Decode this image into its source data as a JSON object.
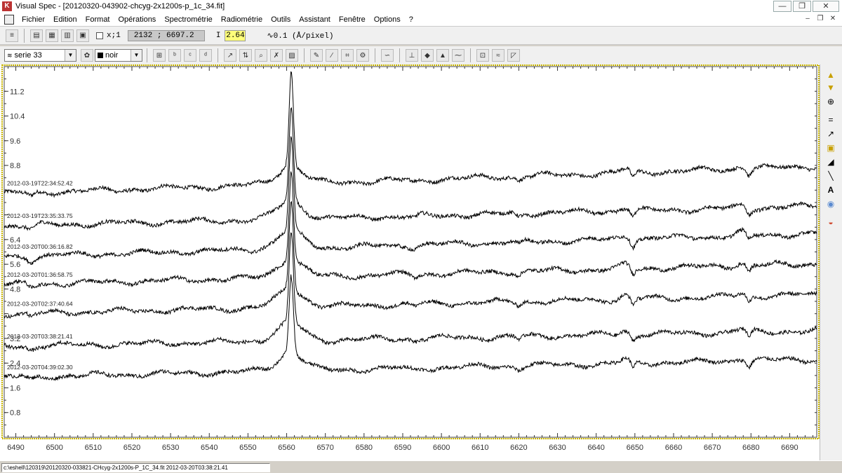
{
  "window": {
    "title": "Visual Spec - [20120320-043902-chcyg-2x1200s-p_1c_34.fit]",
    "app_icon_glyph": "K",
    "minimize_glyph": "—",
    "maximize_glyph": "❐",
    "close_glyph": "✕"
  },
  "menu": {
    "items": [
      "Fichier",
      "Edition",
      "Format",
      "Opérations",
      "Spectrométrie",
      "Radiométrie",
      "Outils",
      "Assistant",
      "Fenêtre",
      "Options",
      "?"
    ],
    "mdi_min_glyph": "–",
    "mdi_restore_glyph": "❐",
    "mdi_close_glyph": "✕"
  },
  "toolbar1": {
    "zoom_label": "x;1",
    "coords": "2132 ; 6697.2",
    "intensity_label": "I",
    "intensity_value": "2.64",
    "dispersion_label": "0.1 (Å/pixel)"
  },
  "toolbar2": {
    "series_value": "serie 33",
    "color_value": "noir"
  },
  "icons": {
    "toolbar1": [
      "columns-icon",
      "open-folder-icon",
      "open-profile-icon",
      "print-icon",
      "save-icon"
    ],
    "toolbar2": [
      "grid-icon",
      "axis-b-icon",
      "axis-c-icon",
      "axis-d-icon",
      "cursor-icon",
      "scale-icon",
      "zoom-icon",
      "delete-icon",
      "image-icon",
      "pen-icon",
      "line-icon",
      "measure-icon",
      "calibrate-icon",
      "continuum-icon",
      "drop-icon",
      "flux-icon",
      "chart-icon",
      "wave-icon",
      "table-icon",
      "chart-alt-icon",
      "spectrum-icon"
    ],
    "right": [
      "arrow-up-icon",
      "arrow-down-icon",
      "lock-icon",
      "equals-icon",
      "graph-icon",
      "rectangle-icon",
      "gradient-icon",
      "line-tool-icon",
      "text-tool-icon",
      "disk-icon",
      "rainbow-icon"
    ]
  },
  "statusbar": {
    "path": "c:\\eshell\\120319\\20120320-033821-CHcyg-2x1200s-P_1C_34.fit 2012-03-20T03:38:21.41"
  },
  "colors": {
    "frame": "#c8b400",
    "trace": "#000000",
    "intensity_bg": "#ffff7a"
  },
  "chart_data": {
    "type": "line",
    "xlim": [
      6487,
      6697
    ],
    "ylim": [
      0.0,
      12.0
    ],
    "x_ticks": [
      6490,
      6500,
      6510,
      6520,
      6530,
      6540,
      6550,
      6560,
      6570,
      6580,
      6590,
      6600,
      6610,
      6620,
      6630,
      6640,
      6650,
      6660,
      6670,
      6680,
      6690
    ],
    "y_ticks": [
      0.8,
      1.6,
      2.4,
      3.2,
      4.0,
      4.8,
      5.6,
      6.4,
      7.2,
      8.0,
      8.8,
      9.6,
      10.4,
      11.2
    ],
    "y_tick_labels": [
      "0.8",
      "1.6",
      "2.4",
      "3.2",
      "",
      "4.8",
      "5.6",
      "6.4",
      "",
      "",
      "8.8",
      "9.6",
      "10.4",
      "11.2"
    ],
    "line_center": 6561.2,
    "series": [
      {
        "name": "2012-03-19T22:34:52.42",
        "baseline": 7.9,
        "peak": 3.05,
        "slope": 0.0042
      },
      {
        "name": "2012-03-19T23:35:33.75",
        "baseline": 6.85,
        "peak": 3.0,
        "slope": 0.003
      },
      {
        "name": "2012-03-20T00:36:16.82",
        "baseline": 5.85,
        "peak": 2.95,
        "slope": 0.0036
      },
      {
        "name": "2012-03-20T01:36:58.75",
        "baseline": 4.95,
        "peak": 2.9,
        "slope": 0.0032
      },
      {
        "name": "2012-03-20T02:37:40.64",
        "baseline": 4.0,
        "peak": 2.9,
        "slope": 0.003
      },
      {
        "name": "2012-03-20T03:38:21.41",
        "baseline": 2.95,
        "peak": 2.9,
        "slope": 0.0024
      },
      {
        "name": "2012-03-20T04:39:02.30",
        "baseline": 1.95,
        "peak": 2.5,
        "slope": 0.0028
      }
    ]
  }
}
